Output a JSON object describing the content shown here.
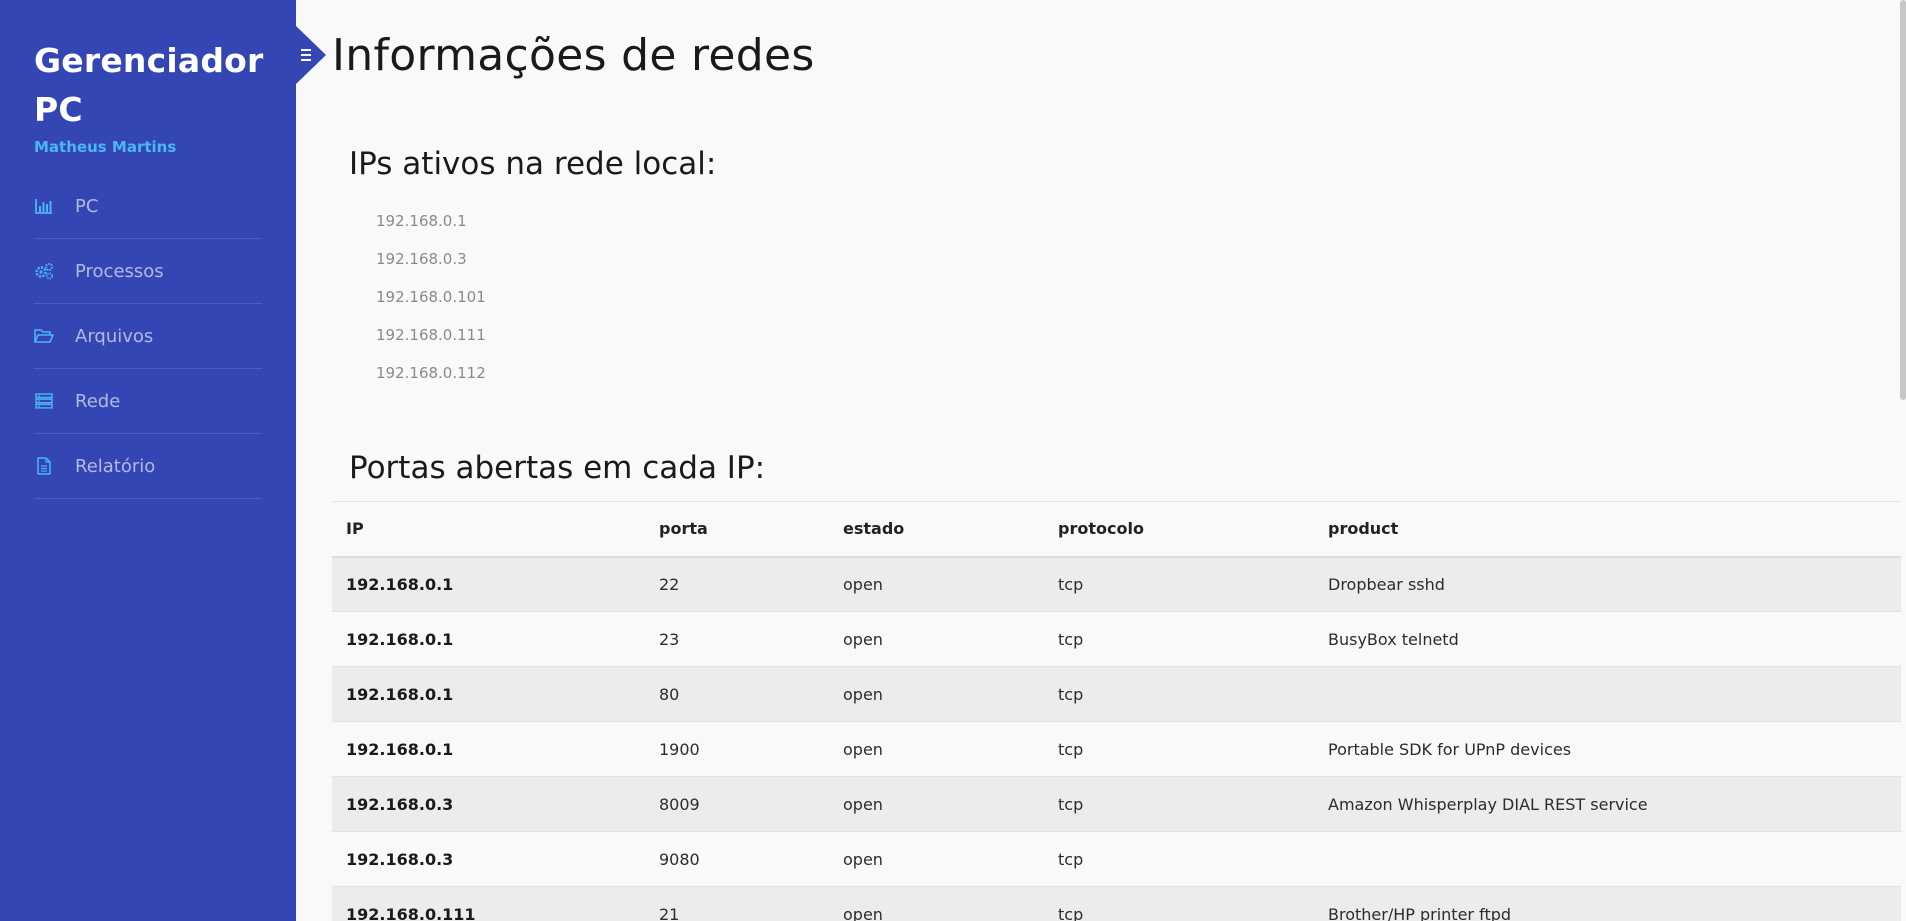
{
  "sidebar": {
    "brand": "Gerenciador PC",
    "user": "Matheus Martins",
    "items": [
      {
        "label": "PC",
        "icon": "bar-chart-icon"
      },
      {
        "label": "Processos",
        "icon": "cogs-icon"
      },
      {
        "label": "Arquivos",
        "icon": "folder-open-icon"
      },
      {
        "label": "Rede",
        "icon": "server-icon"
      },
      {
        "label": "Relatório",
        "icon": "document-icon"
      }
    ],
    "colors": {
      "background": "#3445b4",
      "accent": "#4ab6f5"
    }
  },
  "main": {
    "title": "Informações de redes",
    "ips_section_title": "IPs ativos na rede local:",
    "ips": [
      "192.168.0.1",
      "192.168.0.3",
      "192.168.0.101",
      "192.168.0.111",
      "192.168.0.112"
    ],
    "ports_section_title": "Portas abertas em cada IP:",
    "table": {
      "headers": [
        "IP",
        "porta",
        "estado",
        "protocolo",
        "product"
      ],
      "rows": [
        [
          "192.168.0.1",
          "22",
          "open",
          "tcp",
          "Dropbear sshd"
        ],
        [
          "192.168.0.1",
          "23",
          "open",
          "tcp",
          "BusyBox telnetd"
        ],
        [
          "192.168.0.1",
          "80",
          "open",
          "tcp",
          ""
        ],
        [
          "192.168.0.1",
          "1900",
          "open",
          "tcp",
          "Portable SDK for UPnP devices"
        ],
        [
          "192.168.0.3",
          "8009",
          "open",
          "tcp",
          "Amazon Whisperplay DIAL REST service"
        ],
        [
          "192.168.0.3",
          "9080",
          "open",
          "tcp",
          ""
        ],
        [
          "192.168.0.111",
          "21",
          "open",
          "tcp",
          "Brother/HP printer ftpd"
        ]
      ]
    }
  }
}
